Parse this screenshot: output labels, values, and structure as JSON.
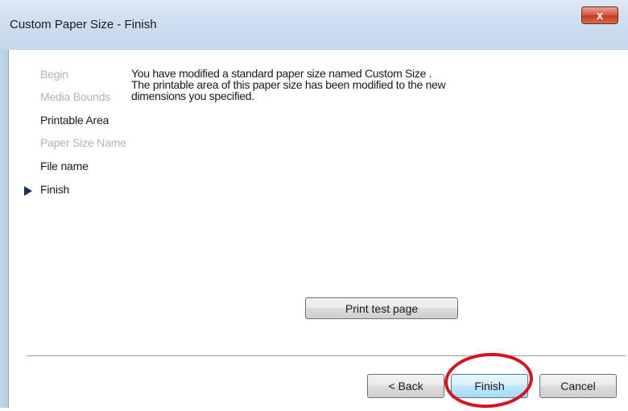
{
  "window": {
    "title": "Custom Paper Size - Finish",
    "close_label": "x"
  },
  "steps": [
    {
      "label": "Begin",
      "state": "disabled"
    },
    {
      "label": "Media Bounds",
      "state": "disabled"
    },
    {
      "label": "Printable Area",
      "state": "enabled"
    },
    {
      "label": "Paper Size Name",
      "state": "disabled"
    },
    {
      "label": "File name",
      "state": "enabled"
    },
    {
      "label": "Finish",
      "state": "current"
    }
  ],
  "message": {
    "line1": "You have modified a standard paper size named  Custom Size .",
    "line2": "The printable area of this paper size has been modified to the new",
    "line3": "dimensions you specified."
  },
  "buttons": {
    "print_test_page": "Print test page",
    "back": "< Back",
    "finish": "Finish",
    "cancel": "Cancel"
  },
  "colors": {
    "annotation_circle": "#d9121f",
    "current_step_arrow": "#1b2a6b"
  }
}
